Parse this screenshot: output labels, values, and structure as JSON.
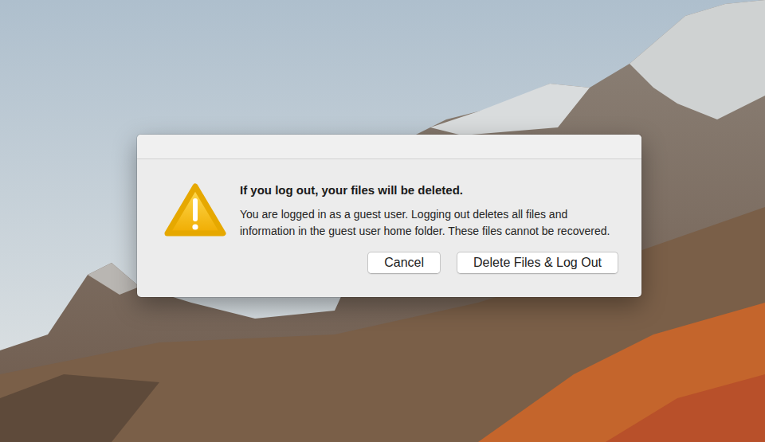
{
  "dialog": {
    "title": "If you log out, your files will be deleted.",
    "message": "You are logged in as a guest user. Logging out deletes all files and information in the guest user home folder. These files cannot be recovered."
  },
  "buttons": [
    {
      "label": "Cancel"
    },
    {
      "label": "Delete Files & Log Out"
    }
  ]
}
